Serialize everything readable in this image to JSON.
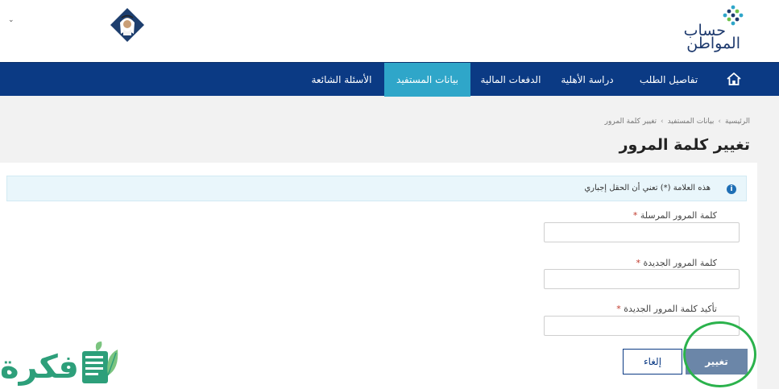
{
  "header": {
    "logo_line1": "حساب",
    "logo_line2": "المواطن",
    "user_menu_chevron": "⌄"
  },
  "navbar": {
    "home_icon": "home-icon",
    "items": [
      {
        "label": "تفاصيل الطلب",
        "active": false
      },
      {
        "label": "دراسة الأهلية",
        "active": false
      },
      {
        "label": "الدفعات المالية",
        "active": false
      },
      {
        "label": "بيانات المستفيد",
        "active": true
      },
      {
        "label": "الأسئلة الشائعة",
        "active": false
      }
    ]
  },
  "breadcrumb": {
    "items": [
      "الرئيسية",
      "بيانات المستفيد",
      "تغيير كلمة المرور"
    ],
    "separator": "›"
  },
  "page": {
    "title": "تغيير كلمة المرور"
  },
  "alert": {
    "text": "هذه العلامة (*) تعني أن الحقل إجباري",
    "icon": "i"
  },
  "form": {
    "fields": [
      {
        "label": "كلمة المرور المرسلة",
        "required_mark": "*",
        "value": ""
      },
      {
        "label": "كلمة المرور الجديدة",
        "required_mark": "*",
        "value": ""
      },
      {
        "label": "تأكيد كلمة المرور الجديدة",
        "required_mark": "*",
        "value": ""
      }
    ],
    "submit_label": "تغيير",
    "cancel_label": "إلغاء"
  },
  "watermark": {
    "text": "فكرة"
  },
  "colors": {
    "navbar": "#0b3a84",
    "nav_active": "#2fa6c9",
    "submit": "#6b86a8",
    "annotation": "#2bb24c",
    "watermark": "#2d9f7a"
  }
}
